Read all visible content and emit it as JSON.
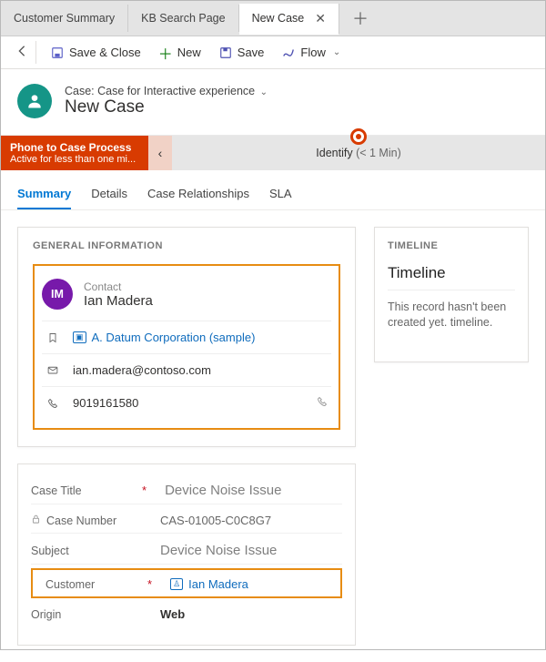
{
  "tabs": {
    "customer": "Customer Summary",
    "kb": "KB Search Page",
    "newcase": "New Case"
  },
  "toolbar": {
    "save_close": "Save & Close",
    "new": "New",
    "save": "Save",
    "flow": "Flow"
  },
  "header": {
    "breadcrumb": "Case: Case for Interactive experience",
    "title": "New Case"
  },
  "process": {
    "name": "Phone to Case Process",
    "status": "Active for less than one mi...",
    "stage": "Identify",
    "duration": "(< 1 Min)"
  },
  "ctabs": {
    "summary": "Summary",
    "details": "Details",
    "rel": "Case Relationships",
    "sla": "SLA"
  },
  "general": {
    "section": "GENERAL INFORMATION",
    "initials": "IM",
    "contact_label": "Contact",
    "contact_name": "Ian Madera",
    "company": "A. Datum Corporation (sample)",
    "email": "ian.madera@contoso.com",
    "phone": "9019161580"
  },
  "timeline": {
    "section": "TIMELINE",
    "title": "Timeline",
    "msg": "This record hasn't been created yet. timeline."
  },
  "form": {
    "case_title_label": "Case Title",
    "case_title": "Device Noise Issue",
    "case_number_label": "Case Number",
    "case_number": "CAS-01005-C0C8G7",
    "subject_label": "Subject",
    "subject": "Device Noise Issue",
    "customer_label": "Customer",
    "customer": "Ian Madera",
    "origin_label": "Origin",
    "origin": "Web"
  }
}
